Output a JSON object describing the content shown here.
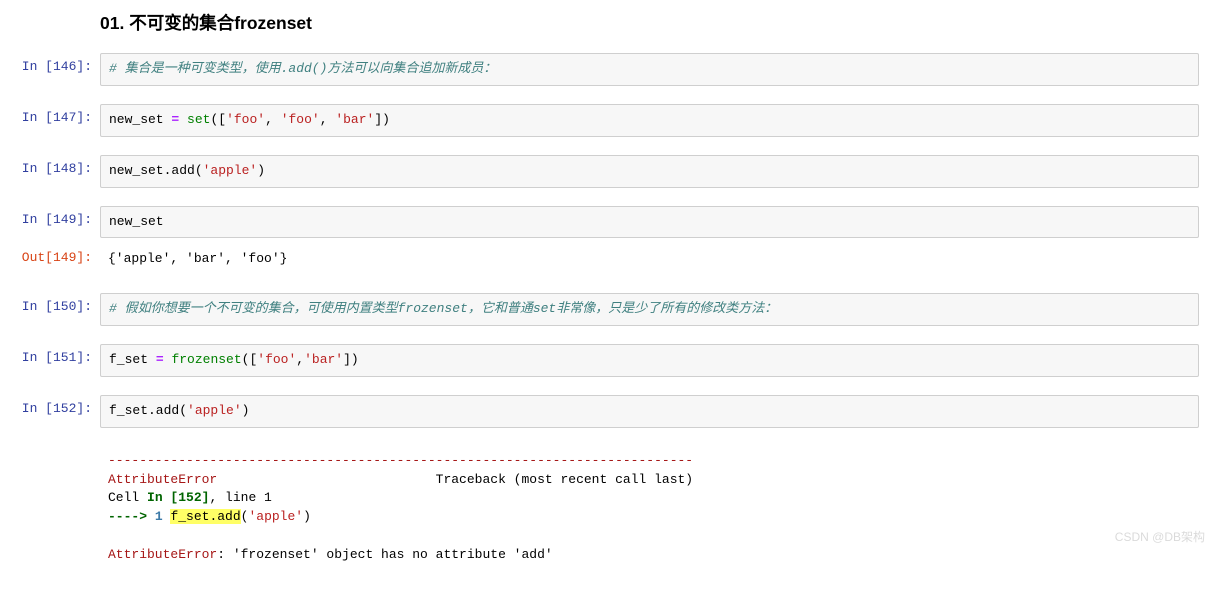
{
  "heading": "01.  不可变的集合frozenset",
  "cells": [
    {
      "kind": "code",
      "prompt_num": "146",
      "tokens": [
        {
          "cls": "tok-comment",
          "t": "# 集合是一种可变类型，使用.add()方法可以向集合追加新成员："
        }
      ]
    },
    {
      "kind": "code",
      "prompt_num": "147",
      "tokens": [
        {
          "cls": "tok-plain",
          "t": "new_set "
        },
        {
          "cls": "tok-op",
          "t": "="
        },
        {
          "cls": "tok-plain",
          "t": " "
        },
        {
          "cls": "tok-builtin",
          "t": "set"
        },
        {
          "cls": "tok-plain",
          "t": "(["
        },
        {
          "cls": "tok-str",
          "t": "'foo'"
        },
        {
          "cls": "tok-plain",
          "t": ", "
        },
        {
          "cls": "tok-str",
          "t": "'foo'"
        },
        {
          "cls": "tok-plain",
          "t": ", "
        },
        {
          "cls": "tok-str",
          "t": "'bar'"
        },
        {
          "cls": "tok-plain",
          "t": "])"
        }
      ]
    },
    {
      "kind": "code",
      "prompt_num": "148",
      "tokens": [
        {
          "cls": "tok-plain",
          "t": "new_set.add("
        },
        {
          "cls": "tok-str",
          "t": "'apple'"
        },
        {
          "cls": "tok-plain",
          "t": ")"
        }
      ]
    },
    {
      "kind": "code",
      "prompt_num": "149",
      "tokens": [
        {
          "cls": "tok-plain",
          "t": "new_set"
        }
      ]
    },
    {
      "kind": "out",
      "prompt_num": "149",
      "text": "{'apple', 'bar', 'foo'}"
    },
    {
      "kind": "code",
      "prompt_num": "150",
      "tokens": [
        {
          "cls": "tok-comment",
          "t": "# 假如你想要一个不可变的集合，可使用内置类型frozenset，它和普通set非常像，只是少了所有的修改类方法："
        }
      ]
    },
    {
      "kind": "code",
      "prompt_num": "151",
      "tokens": [
        {
          "cls": "tok-plain",
          "t": "f_set "
        },
        {
          "cls": "tok-op",
          "t": "="
        },
        {
          "cls": "tok-plain",
          "t": " "
        },
        {
          "cls": "tok-builtin",
          "t": "frozenset"
        },
        {
          "cls": "tok-plain",
          "t": "(["
        },
        {
          "cls": "tok-str",
          "t": "'foo'"
        },
        {
          "cls": "tok-plain",
          "t": ","
        },
        {
          "cls": "tok-str",
          "t": "'bar'"
        },
        {
          "cls": "tok-plain",
          "t": "])"
        }
      ]
    },
    {
      "kind": "code",
      "prompt_num": "152",
      "tokens": [
        {
          "cls": "tok-plain",
          "t": "f_set.add("
        },
        {
          "cls": "tok-str",
          "t": "'apple'"
        },
        {
          "cls": "tok-plain",
          "t": ")"
        }
      ]
    }
  ],
  "traceback": {
    "sep": "---------------------------------------------------------------------------",
    "err_name": "AttributeError",
    "tb_label": "Traceback (most recent call last)",
    "cell_label_pre": "Cell ",
    "cell_label_in": "In [152]",
    "cell_label_post": ", line 1",
    "arrow": "----> ",
    "lineno": "1",
    "hl": "f_set.add",
    "hl_open": "(",
    "hl_str": "'apple'",
    "hl_close": ")",
    "final_err": "AttributeError",
    "final_msg": ": 'frozenset' object has no attribute 'add'"
  },
  "watermark": "CSDN @DB架构"
}
